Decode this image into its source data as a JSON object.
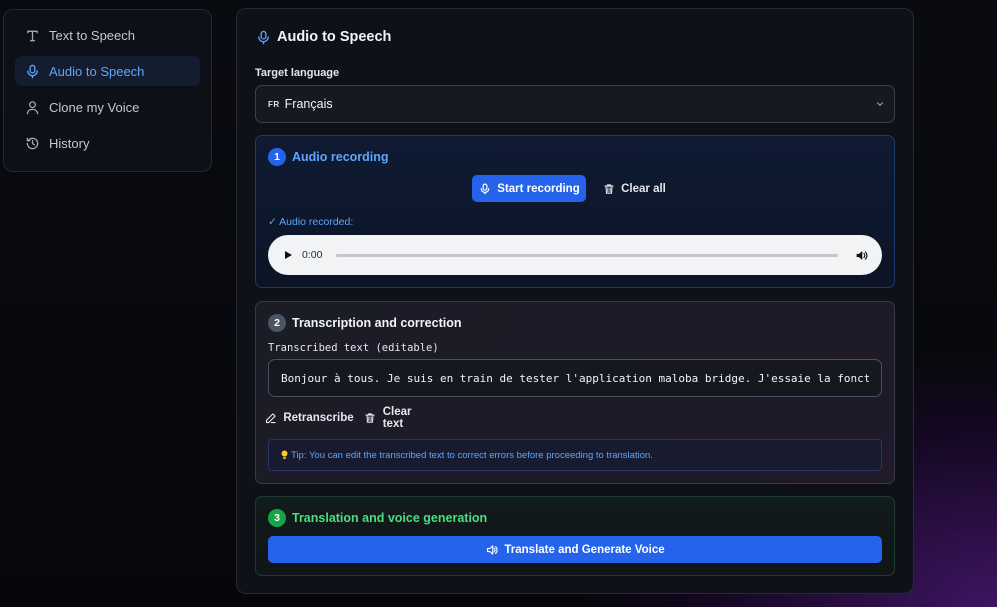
{
  "sidebar": {
    "items": [
      {
        "label": "Text to Speech",
        "icon": "text-icon"
      },
      {
        "label": "Audio to Speech",
        "icon": "microphone-icon",
        "active": true
      },
      {
        "label": "Clone my Voice",
        "icon": "user-icon"
      },
      {
        "label": "History",
        "icon": "history-icon"
      }
    ]
  },
  "main": {
    "title": "Audio to Speech",
    "target_language_label": "Target language",
    "target_language": {
      "flag": "FR",
      "value": "Français"
    },
    "section1": {
      "step": "1",
      "title": "Audio recording",
      "start_recording": "Start recording",
      "clear_all": "Clear all",
      "recorded_label": "✓ Audio recorded:",
      "player_time": "0:00",
      "progress": 0
    },
    "section2": {
      "step": "2",
      "title": "Transcription and correction",
      "text_label": "Transcribed text (editable)",
      "text_value": "Bonjour à tous. Je suis en train de tester l'application maloba bridge. J'essaie la fonctionnalité de traduction.",
      "retranscribe": "Retranscribe",
      "clear_text": "Clear text",
      "tip": "Tip: You can edit the transcribed text to correct errors before proceeding to translation."
    },
    "section3": {
      "step": "3",
      "title": "Translation and voice generation",
      "translate_button": "Translate and Generate Voice"
    }
  },
  "colors": {
    "accent": "#2563eb",
    "accent_text": "#60a5fa",
    "success": "#4ade80"
  }
}
